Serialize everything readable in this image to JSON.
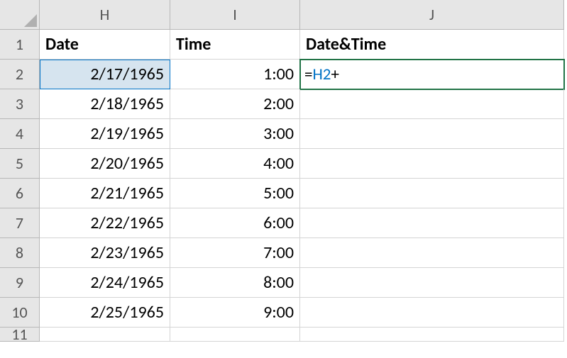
{
  "columns": [
    "H",
    "I",
    "J"
  ],
  "row_numbers": [
    "1",
    "2",
    "3",
    "4",
    "5",
    "6",
    "7",
    "8",
    "9",
    "10",
    "11"
  ],
  "headers": {
    "H": "Date",
    "I": "Time",
    "J": "Date&Time"
  },
  "rows": [
    {
      "date": "2/17/1965",
      "time": "1:00"
    },
    {
      "date": "2/18/1965",
      "time": "2:00"
    },
    {
      "date": "2/19/1965",
      "time": "3:00"
    },
    {
      "date": "2/20/1965",
      "time": "4:00"
    },
    {
      "date": "2/21/1965",
      "time": "5:00"
    },
    {
      "date": "2/22/1965",
      "time": "6:00"
    },
    {
      "date": "2/23/1965",
      "time": "7:00"
    },
    {
      "date": "2/24/1965",
      "time": "8:00"
    },
    {
      "date": "2/25/1965",
      "time": "9:00"
    }
  ],
  "active_cell": {
    "address": "J2",
    "formula_parts": {
      "eq": "=",
      "ref": "H2",
      "op": "+"
    },
    "referenced": "H2"
  },
  "chart_data": {
    "type": "table",
    "columns": [
      "Date",
      "Time",
      "Date&Time"
    ],
    "data": [
      [
        "2/17/1965",
        "1:00",
        "=H2+"
      ],
      [
        "2/18/1965",
        "2:00",
        ""
      ],
      [
        "2/19/1965",
        "3:00",
        ""
      ],
      [
        "2/20/1965",
        "4:00",
        ""
      ],
      [
        "2/21/1965",
        "5:00",
        ""
      ],
      [
        "2/22/1965",
        "6:00",
        ""
      ],
      [
        "2/23/1965",
        "7:00",
        ""
      ],
      [
        "2/24/1965",
        "8:00",
        ""
      ],
      [
        "2/25/1965",
        "9:00",
        ""
      ]
    ]
  }
}
